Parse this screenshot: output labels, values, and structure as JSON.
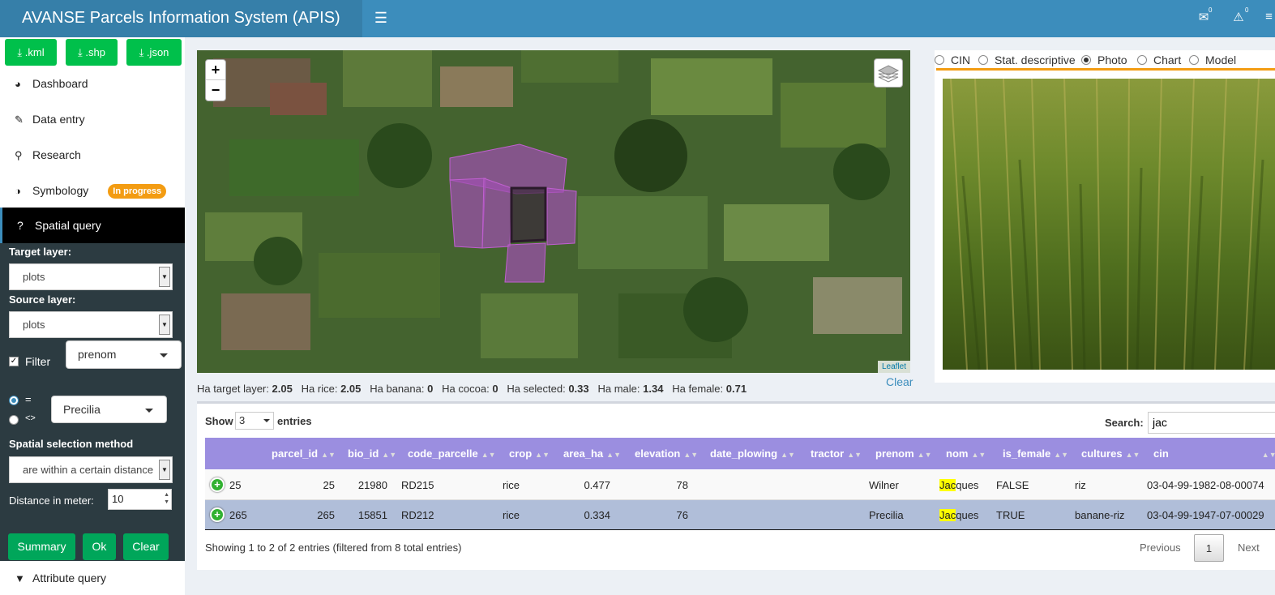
{
  "header": {
    "title": "AVANSE Parcels Information System (APIS)",
    "menu_icon": "hamburger-icon",
    "notif_count": "0",
    "alert_count": "0"
  },
  "downloads": [
    ".kml",
    ".shp",
    ".json"
  ],
  "menu": {
    "dashboard": "Dashboard",
    "data_entry": "Data entry",
    "research": "Research",
    "symbology": "Symbology",
    "symbology_badge": "In progress",
    "spatial_query": "Spatial query",
    "attribute_query": "Attribute query"
  },
  "spatial": {
    "target_label": "Target layer:",
    "target_value": "plots",
    "source_label": "Source layer:",
    "source_value": "plots",
    "filter_label": "Filter",
    "filter_field": "prenom",
    "op_eq": "=",
    "op_neq": "<>",
    "filter_value": "Precilia",
    "method_label": "Spatial selection method",
    "method_value": "are within a certain distance",
    "distance_label": "Distance in meter:",
    "distance_value": "10",
    "btn_summary": "Summary",
    "btn_ok": "Ok",
    "btn_clear": "Clear"
  },
  "map": {
    "zoom_in": "+",
    "zoom_out": "−",
    "attribution": "Leaflet",
    "clear": "Clear"
  },
  "stats": [
    {
      "label": "Ha target layer:",
      "value": "2.05"
    },
    {
      "label": "Ha rice:",
      "value": "2.05"
    },
    {
      "label": "Ha banana:",
      "value": "0"
    },
    {
      "label": "Ha cocoa:",
      "value": "0"
    },
    {
      "label": "Ha selected:",
      "value": "0.33"
    },
    {
      "label": "Ha male:",
      "value": "1.34"
    },
    {
      "label": "Ha female:",
      "value": "0.71"
    }
  ],
  "panel_tabs": [
    "CIN",
    "Stat. descriptive",
    "Photo",
    "Chart",
    "Model"
  ],
  "panel_selected": "Photo",
  "table": {
    "show_label": "Show",
    "show_value": "3",
    "entries_label": "entries",
    "search_label": "Search:",
    "search_value": "jac",
    "columns": [
      "parcel_id",
      "bio_id",
      "code_parcelle",
      "crop",
      "area_ha",
      "elevation",
      "date_plowing",
      "tractor",
      "prenom",
      "nom",
      "is_female",
      "cultures",
      "cin"
    ],
    "rows": [
      {
        "rownum": "25",
        "parcel_id": "25",
        "bio_id": "21980",
        "code_parcelle": "RD215",
        "crop": "rice",
        "area_ha": "0.477",
        "elevation": "78",
        "date_plowing": "",
        "tractor": "",
        "prenom": "Wilner",
        "nom_hl": "Jac",
        "nom_rest": "ques",
        "is_female": "FALSE",
        "cultures": "riz",
        "cin": "03-04-99-1982-08-00074"
      },
      {
        "rownum": "265",
        "parcel_id": "265",
        "bio_id": "15851",
        "code_parcelle": "RD212",
        "crop": "rice",
        "area_ha": "0.334",
        "elevation": "76",
        "date_plowing": "",
        "tractor": "",
        "prenom": "Precilia",
        "nom_hl": "Jac",
        "nom_rest": "ques",
        "is_female": "TRUE",
        "cultures": "banane-riz",
        "cin": "03-04-99-1947-07-00029"
      }
    ],
    "info": "Showing 1 to 2 of 2 entries (filtered from 8 total entries)",
    "prev": "Previous",
    "page": "1",
    "next": "Next"
  }
}
